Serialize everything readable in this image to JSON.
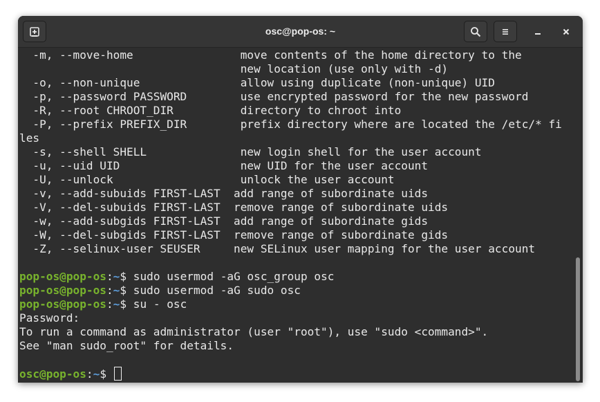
{
  "window": {
    "title": "osc@pop-os: ~"
  },
  "icons": {
    "new_tab": "new-tab-plus-icon",
    "search": "search-icon",
    "menu": "hamburger-menu-icon",
    "minimize": "minimize-icon",
    "close": "close-icon"
  },
  "terminal": {
    "help_lines": [
      "  -m, --move-home                move contents of the home directory to the",
      "                                 new location (use only with -d)",
      "  -o, --non-unique               allow using duplicate (non-unique) UID",
      "  -p, --password PASSWORD        use encrypted password for the new password",
      "  -R, --root CHROOT_DIR          directory to chroot into",
      "  -P, --prefix PREFIX_DIR        prefix directory where are located the /etc/* fi",
      "les",
      "  -s, --shell SHELL              new login shell for the user account",
      "  -u, --uid UID                  new UID for the user account",
      "  -U, --unlock                   unlock the user account",
      "  -v, --add-subuids FIRST-LAST  add range of subordinate uids",
      "  -V, --del-subuids FIRST-LAST  remove range of subordinate uids",
      "  -w, --add-subgids FIRST-LAST  add range of subordinate gids",
      "  -W, --del-subgids FIRST-LAST  remove range of subordinate gids",
      "  -Z, --selinux-user SEUSER     new SELinux user mapping for the user account"
    ],
    "commands": [
      {
        "user_host": "pop-os@pop-os",
        "sep": ":",
        "path": "~",
        "sym": "$ ",
        "cmd": "sudo usermod -aG osc_group osc"
      },
      {
        "user_host": "pop-os@pop-os",
        "sep": ":",
        "path": "~",
        "sym": "$ ",
        "cmd": "sudo usermod -aG sudo osc"
      },
      {
        "user_host": "pop-os@pop-os",
        "sep": ":",
        "path": "~",
        "sym": "$ ",
        "cmd": "su - osc"
      }
    ],
    "output_lines": [
      "Password:",
      "To run a command as administrator (user \"root\"), use \"sudo <command>\".",
      "See \"man sudo_root\" for details."
    ],
    "final_prompt": {
      "user_host": "osc@pop-os",
      "sep": ":",
      "path": "~",
      "sym": "$ "
    }
  }
}
